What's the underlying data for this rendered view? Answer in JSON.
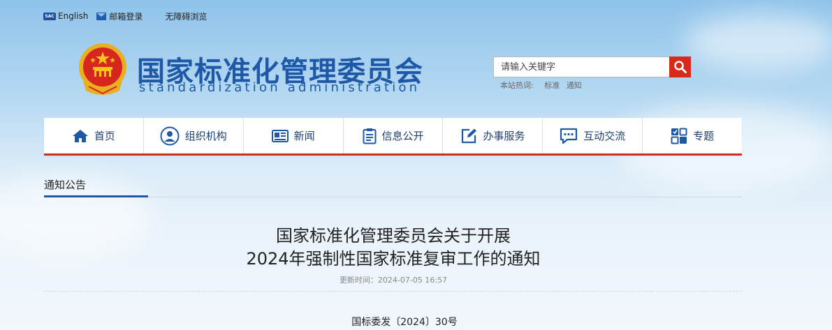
{
  "topbar": {
    "logo_badge": "SAC",
    "english": "English",
    "mail_login": "邮箱登录",
    "accessible": "无障碍浏览"
  },
  "header": {
    "title": "国家标准化管理委员会",
    "subtitle": "standardization administration"
  },
  "search": {
    "placeholder": "请输入关键字",
    "hot_label": "本站热词:",
    "hot_words": [
      "标准",
      "通知"
    ]
  },
  "nav": {
    "items": [
      {
        "label": "首页",
        "icon": "home-icon"
      },
      {
        "label": "组织机构",
        "icon": "user-circle-icon"
      },
      {
        "label": "新闻",
        "icon": "newspaper-icon"
      },
      {
        "label": "信息公开",
        "icon": "clipboard-icon"
      },
      {
        "label": "办事服务",
        "icon": "edit-icon"
      },
      {
        "label": "互动交流",
        "icon": "chat-icon"
      },
      {
        "label": "专题",
        "icon": "topic-icon"
      }
    ]
  },
  "breadcrumb": {
    "section": "通知公告"
  },
  "article": {
    "title_line1": "国家标准化管理委员会关于开展",
    "title_line2": "2024年强制性国家标准复审工作的通知",
    "update_time": "更新时间：2024-07-05 16:57",
    "doc_number": "国标委发〔2024〕30号"
  },
  "colors": {
    "brand_blue": "#1e58a6",
    "accent_red": "#d42a24",
    "search_button": "#d7291c"
  }
}
